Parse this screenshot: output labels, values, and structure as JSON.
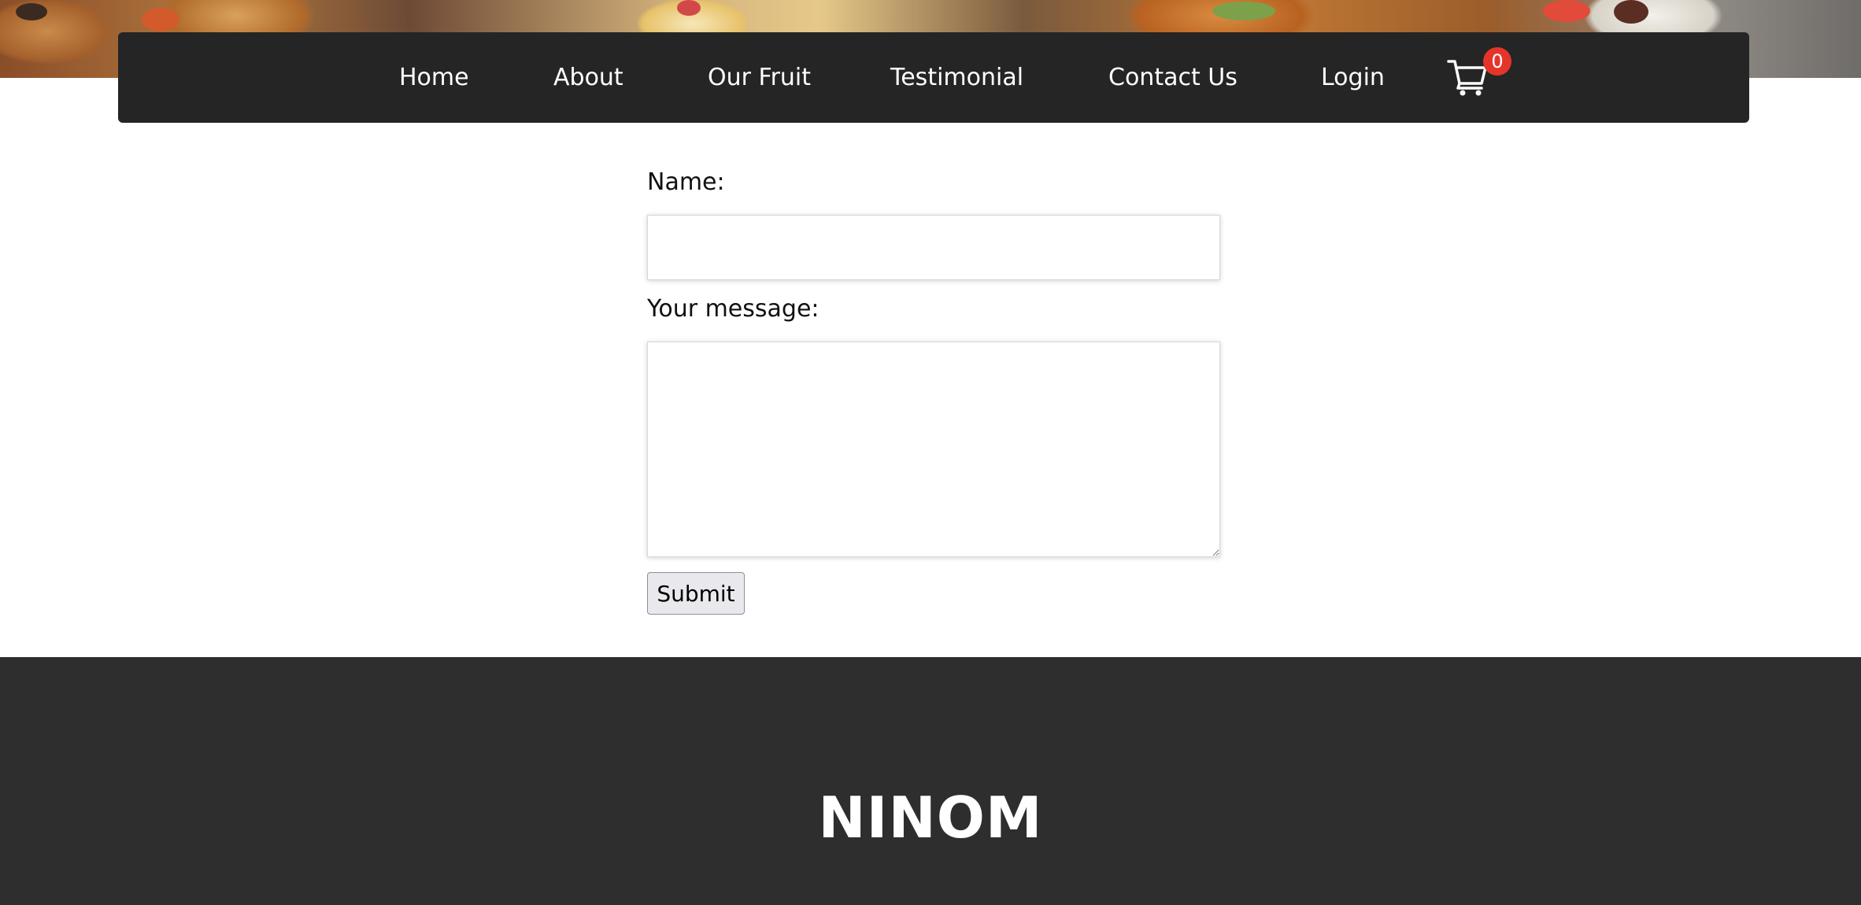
{
  "nav": {
    "items": [
      {
        "label": "Home"
      },
      {
        "label": "About"
      },
      {
        "label": "Our Fruit"
      },
      {
        "label": "Testimonial"
      },
      {
        "label": "Contact Us"
      },
      {
        "label": "Login"
      }
    ],
    "cart_icon": "shopping-cart-icon",
    "cart_count": "0"
  },
  "form": {
    "name_label": "Name:",
    "name_value": "",
    "message_label": "Your message:",
    "message_value": "",
    "submit_label": "Submit"
  },
  "footer": {
    "brand": "NINOM"
  },
  "colors": {
    "navbar": "#252525",
    "footer": "#2e2e2e",
    "badge": "#e5352b"
  }
}
